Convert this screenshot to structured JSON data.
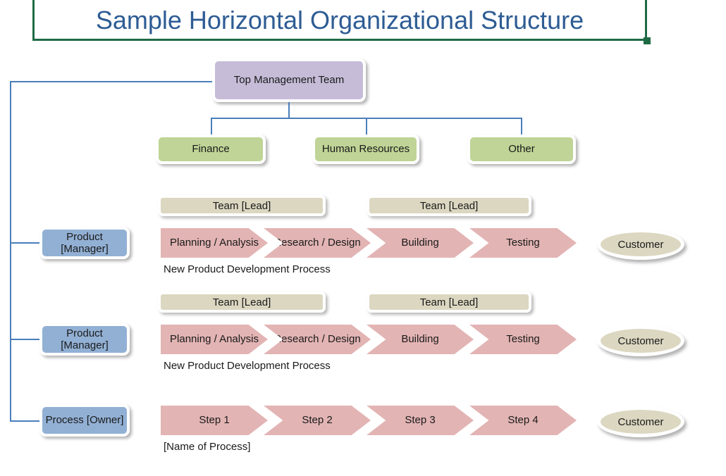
{
  "title": {
    "text": "Sample Horizontal Organizational Structure",
    "border_color": "#1f6b45",
    "text_color": "#2e5c94"
  },
  "colors": {
    "top_management": "#c6bcd8",
    "function_box": "#bfd496",
    "owner_box": "#92b0d4",
    "team_bar": "#dcd7c1",
    "process_step": "#e3b4b4",
    "customer": "#dcd7c1",
    "connector": "#4a7ebb"
  },
  "top_management": {
    "label": "Top Management Team"
  },
  "functions": [
    {
      "label": "Finance"
    },
    {
      "label": "Human Resources"
    },
    {
      "label": "Other"
    }
  ],
  "rows": [
    {
      "owner": {
        "label": "Product [Manager]"
      },
      "teams": [
        {
          "label": "Team [Lead]"
        },
        {
          "label": "Team [Lead]"
        }
      ],
      "steps": [
        {
          "label": "Planning / Analysis"
        },
        {
          "label": "Research / Design"
        },
        {
          "label": "Building"
        },
        {
          "label": "Testing"
        }
      ],
      "caption": "New Product Development Process",
      "customer": {
        "label": "Customer"
      }
    },
    {
      "owner": {
        "label": "Product [Manager]"
      },
      "teams": [
        {
          "label": "Team [Lead]"
        },
        {
          "label": "Team [Lead]"
        }
      ],
      "steps": [
        {
          "label": "Planning / Analysis"
        },
        {
          "label": "Research / Design"
        },
        {
          "label": "Building"
        },
        {
          "label": "Testing"
        }
      ],
      "caption": "New Product Development Process",
      "customer": {
        "label": "Customer"
      }
    },
    {
      "owner": {
        "label": "Process [Owner]"
      },
      "teams": [],
      "steps": [
        {
          "label": "Step 1"
        },
        {
          "label": "Step 2"
        },
        {
          "label": "Step 3"
        },
        {
          "label": "Step 4"
        }
      ],
      "caption": "[Name of Process]",
      "customer": {
        "label": "Customer"
      }
    }
  ]
}
